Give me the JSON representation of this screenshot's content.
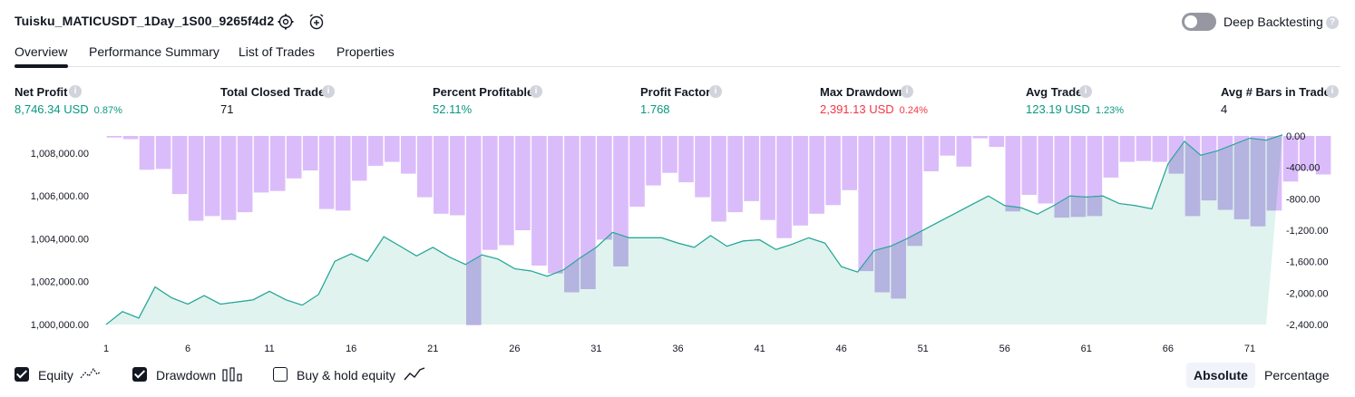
{
  "header": {
    "strategy_title": "Tuisku_MATICUSDT_1Day_1S00_9265f4d2",
    "settings_icon": "gear-icon",
    "alert_icon": "alarm-clock-add-icon",
    "deep_backtesting_label": "Deep Backtesting",
    "deep_backtesting_enabled": false,
    "help_glyph": "?"
  },
  "tabs": [
    {
      "label": "Overview",
      "active": true
    },
    {
      "label": "Performance Summary",
      "active": false
    },
    {
      "label": "List of Trades",
      "active": false
    },
    {
      "label": "Properties",
      "active": false
    }
  ],
  "metrics": [
    {
      "label": "Net Profit",
      "value": "8,746.34 USD",
      "pct": "0.87%",
      "tone": "pos"
    },
    {
      "label": "Total Closed Trades",
      "value": "71",
      "pct": "",
      "tone": "neutral"
    },
    {
      "label": "Percent Profitable",
      "value": "52.11%",
      "pct": "",
      "tone": "pos"
    },
    {
      "label": "Profit Factor",
      "value": "1.768",
      "pct": "",
      "tone": "pos"
    },
    {
      "label": "Max Drawdown",
      "value": "2,391.13 USD",
      "pct": "0.24%",
      "tone": "neg"
    },
    {
      "label": "Avg Trade",
      "value": "123.19 USD",
      "pct": "1.23%",
      "tone": "pos"
    },
    {
      "label": "Avg # Bars in Trades",
      "value": "4",
      "pct": "",
      "tone": "neutral"
    }
  ],
  "legend": {
    "equity": {
      "label": "Equity",
      "checked": true
    },
    "drawdown": {
      "label": "Drawdown",
      "checked": true
    },
    "buy_hold": {
      "label": "Buy & hold equity",
      "checked": false
    }
  },
  "view_buttons": {
    "absolute": "Absolute",
    "percentage": "Percentage",
    "selected": "Absolute"
  },
  "colors": {
    "equity_line": "#26a69a",
    "equity_fill": "#d6efe8",
    "drawdown_bar": "#dbbcfa",
    "drawdown_bar_overlap": "#b5b3e0",
    "positive": "#089981",
    "negative": "#f23645"
  },
  "chart_data": {
    "type": "area",
    "x_ticks": [
      "1",
      "6",
      "11",
      "16",
      "21",
      "26",
      "31",
      "36",
      "41",
      "46",
      "51",
      "56",
      "61",
      "66",
      "71"
    ],
    "left_axis_ticks": [
      "1,008,000.00",
      "1,006,000.00",
      "1,004,000.00",
      "1,002,000.00",
      "1,000,000.00"
    ],
    "right_axis_ticks": [
      "0.00",
      "-400.00",
      "-800.00",
      "-1,200.00",
      "-1,600.00",
      "-2,000.00",
      "-2,400.00"
    ],
    "left_ylim": [
      1000000,
      1008800
    ],
    "right_ylim": [
      -2400,
      0
    ],
    "x": [
      1,
      2,
      3,
      4,
      5,
      6,
      7,
      8,
      9,
      10,
      11,
      12,
      13,
      14,
      15,
      16,
      17,
      18,
      19,
      20,
      21,
      22,
      23,
      24,
      25,
      26,
      27,
      28,
      29,
      30,
      31,
      32,
      33,
      34,
      35,
      36,
      37,
      38,
      39,
      40,
      41,
      42,
      43,
      44,
      45,
      46,
      47,
      48,
      49,
      50,
      51,
      52,
      53,
      54,
      55,
      56,
      57,
      58,
      59,
      60,
      61,
      62,
      63,
      64,
      65,
      66,
      67,
      68,
      69,
      70,
      71,
      72
    ],
    "series": [
      {
        "name": "Equity",
        "values": [
          1000000,
          1000600,
          1000300,
          1001750,
          1001250,
          1000950,
          1001350,
          1000950,
          1001050,
          1001150,
          1001550,
          1001150,
          1000900,
          1001400,
          1002950,
          1003300,
          1002950,
          1004100,
          1003650,
          1003200,
          1003600,
          1003150,
          1002800,
          1003250,
          1003050,
          1002600,
          1002500,
          1002250,
          1002550,
          1003100,
          1003600,
          1004300,
          1004050,
          1004050,
          1004050,
          1003800,
          1003600,
          1004150,
          1003650,
          1003900,
          1003950,
          1003500,
          1003750,
          1004050,
          1003800,
          1002700,
          1002450,
          1003450,
          1003650,
          1004000,
          1004400,
          1004800,
          1005200,
          1005600,
          1006000,
          1005550,
          1005450,
          1005150,
          1005550,
          1006000,
          1005950,
          1006000,
          1005650,
          1005550,
          1005400,
          1007500,
          1008550,
          1007900,
          1008100,
          1008400,
          1008700,
          1008600,
          1008850
        ]
      },
      {
        "name": "Drawdown",
        "values": [
          -20,
          -40,
          -430,
          -420,
          -740,
          -1080,
          -1020,
          -1070,
          -970,
          -720,
          -700,
          -540,
          -440,
          -930,
          -950,
          -570,
          -380,
          -330,
          -480,
          -780,
          -990,
          -1010,
          -2410,
          -1450,
          -1390,
          -1200,
          -1650,
          -1750,
          -1990,
          -1950,
          -1320,
          -1660,
          -900,
          -630,
          -470,
          -590,
          -780,
          -1090,
          -970,
          -830,
          -1070,
          -1300,
          -1140,
          -990,
          -880,
          -690,
          -1720,
          -1990,
          -2070,
          -1400,
          -450,
          -250,
          -390,
          -30,
          -140,
          -960,
          -750,
          -860,
          -1040,
          -1030,
          -1020,
          -530,
          -330,
          -320,
          -330,
          -480,
          -1020,
          -820,
          -940,
          -1060,
          -1150,
          -950,
          -580,
          -440,
          -490
        ]
      }
    ],
    "ylabel": "",
    "xlabel": "",
    "grid": false,
    "legend_position": "bottom-left"
  }
}
